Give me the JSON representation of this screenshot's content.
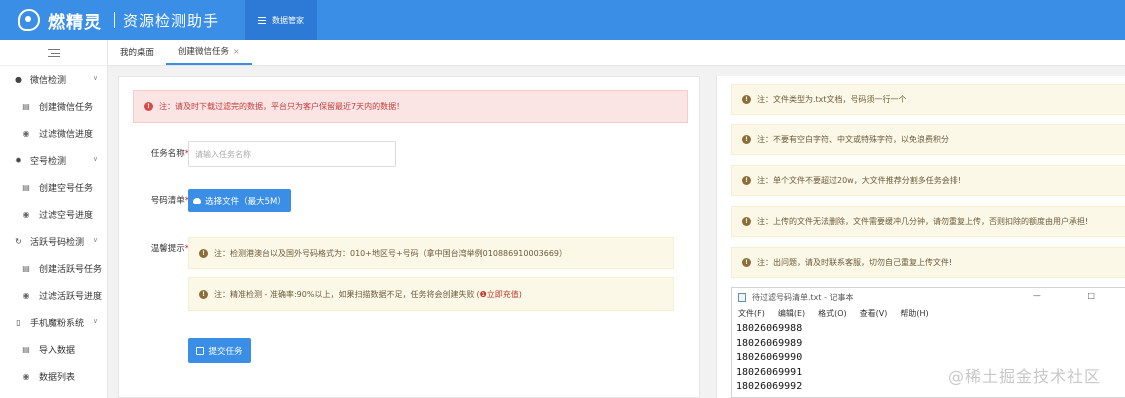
{
  "app": {
    "brand": "燃精灵",
    "subtitle": "资源检测助手",
    "top_nav_label": "数据管家"
  },
  "sidebar": {
    "groups": [
      {
        "label": "微信检测",
        "icon": "chat-icon",
        "items": [
          "创建微信任务",
          "过滤微信进度"
        ]
      },
      {
        "label": "空号检测",
        "icon": "gear-icon",
        "items": [
          "创建空号任务",
          "过滤空号进度"
        ]
      },
      {
        "label": "活跃号码检测",
        "icon": "refresh-icon",
        "items": [
          "创建活跃号任务",
          "过滤活跃号进度"
        ]
      },
      {
        "label": "手机魔粉系统",
        "icon": "phone-icon",
        "items": [
          "导入数据",
          "数据列表"
        ]
      }
    ]
  },
  "tabs": [
    {
      "label": "我的桌面"
    },
    {
      "label": "创建微信任务",
      "close": "×"
    }
  ],
  "left": {
    "alert": "注：请及时下载过滤完的数据，平台只为客户保留最近7天内的数据！",
    "task_name_label": "任务名称",
    "task_name_placeholder": "请输入任务名称",
    "number_list_label": "号码清单",
    "upload_button": "选择文件（最大5M）",
    "tips_label": "温馨提示",
    "tip1": "注：检测港澳台以及国外号码格式为：010+地区号+号码（拿中国台湾举例010886910003669）",
    "tip2": "注：精准检测 - 准确率:90%以上，如果扫描数据不足，任务将会创建失败",
    "tip2_link": "(❶立即充值)",
    "submit_button": "提交任务",
    "required_mark": "*"
  },
  "right": {
    "notes": [
      "注：文件类型为.txt文档，号码须一行一个",
      "注：不要有空白字符、中文或特殊字符，以免浪费积分",
      "注：单个文件不要超过20w，大文件推荐分割多任务会排!",
      "注：上传的文件无法删除，文件需要缓冲几分钟，请勿重复上传，否则扣除的额度由用户承担!",
      "注：出问题，请及时联系客服，切勿自己重复上传文件!"
    ],
    "notepad": {
      "title": "待过滤号码清单.txt - 记事本",
      "controls": "— □",
      "menu": [
        "文件(F)",
        "编辑(E)",
        "格式(O)",
        "查看(V)",
        "帮助(H)"
      ],
      "lines": [
        "18026069988",
        "18026069989",
        "18026069990",
        "18026069991",
        "18026069992"
      ]
    }
  },
  "watermark": "@稀土掘金技术社区"
}
